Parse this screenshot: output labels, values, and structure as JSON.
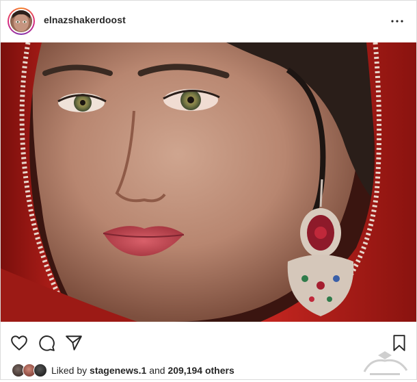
{
  "post": {
    "username": "elnazshakerdoost",
    "more_icon": "more-dots-icon",
    "photo_description_icon": "portrait-photo",
    "actions": {
      "like_icon": "heart-icon",
      "comment_icon": "comment-bubble-icon",
      "share_icon": "paper-plane-icon",
      "save_icon": "bookmark-icon"
    },
    "likes": {
      "prefix": "Liked by",
      "user": "stagenews.1",
      "middle": "and",
      "count": "209,194 others"
    }
  },
  "colors": {
    "text": "#262626",
    "border": "#dbdbdb",
    "scarf_red": "#b0201b"
  }
}
